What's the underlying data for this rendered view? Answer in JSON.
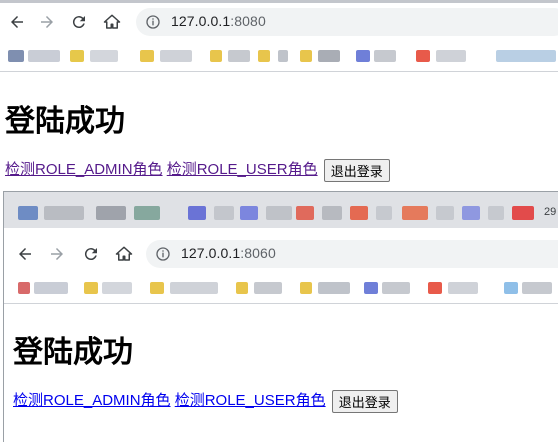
{
  "windows": [
    {
      "url_host": "127.0.0.1",
      "url_port": ":8080",
      "page_title": "登陆成功",
      "link_admin": "检测ROLE_ADMIN角色",
      "link_user": "检测ROLE_USER角色",
      "logout_label": "退出登录"
    },
    {
      "url_host": "127.0.0.1",
      "url_port": ":8060",
      "page_title": "登陆成功",
      "link_admin": "检测ROLE_ADMIN角色",
      "link_user": "检测ROLE_USER角色",
      "logout_label": "退出登录",
      "tab_partial_text": "29"
    }
  ],
  "icons": {
    "back": "arrow-left-icon",
    "forward": "arrow-right-icon",
    "reload": "reload-icon",
    "home": "home-icon",
    "info": "info-icon"
  }
}
